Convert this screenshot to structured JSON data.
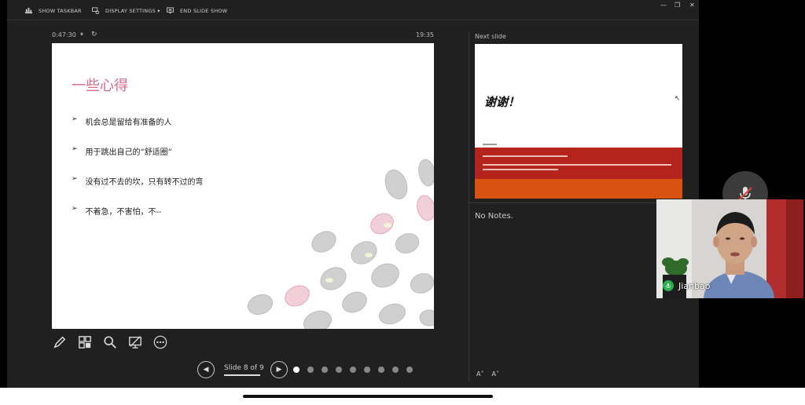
{
  "toolbar": {
    "show_taskbar": "SHOW TASKBAR",
    "display_settings": "DISPLAY SETTINGS ▾",
    "end_slide_show": "END SLIDE SHOW",
    "minimize": "—",
    "restore": "❐",
    "close": "✕"
  },
  "timer": {
    "elapsed": "0:47:30",
    "pause_glyph": "⏸",
    "restart_glyph": "↻",
    "clock": "19:35"
  },
  "slide": {
    "title": "一些心得",
    "bullets": [
      "机会总是留给有准备的人",
      "用于跳出自己的“舒适圈”",
      "没有过不去的坎，只有转不过的弯",
      "不着急，不害怕，不--"
    ],
    "bullet_glyph": "➢"
  },
  "navigation": {
    "prev_glyph": "◀",
    "next_glyph": "▶",
    "slide_label": "Slide 8 of 9",
    "current_slide": 1,
    "dot_count": 9
  },
  "next_slide": {
    "label": "Next slide",
    "title": "谢谢！"
  },
  "notes": {
    "text": "No Notes."
  },
  "font_controls": {
    "increase": "A˄",
    "decrease": "A˅"
  },
  "video": {
    "participant_name": "Jianbao"
  },
  "colors": {
    "slide_title": "#d96a8a",
    "next_red": "#b5241c",
    "next_orange": "#d9520f",
    "mic_active": "#2bb24c"
  }
}
